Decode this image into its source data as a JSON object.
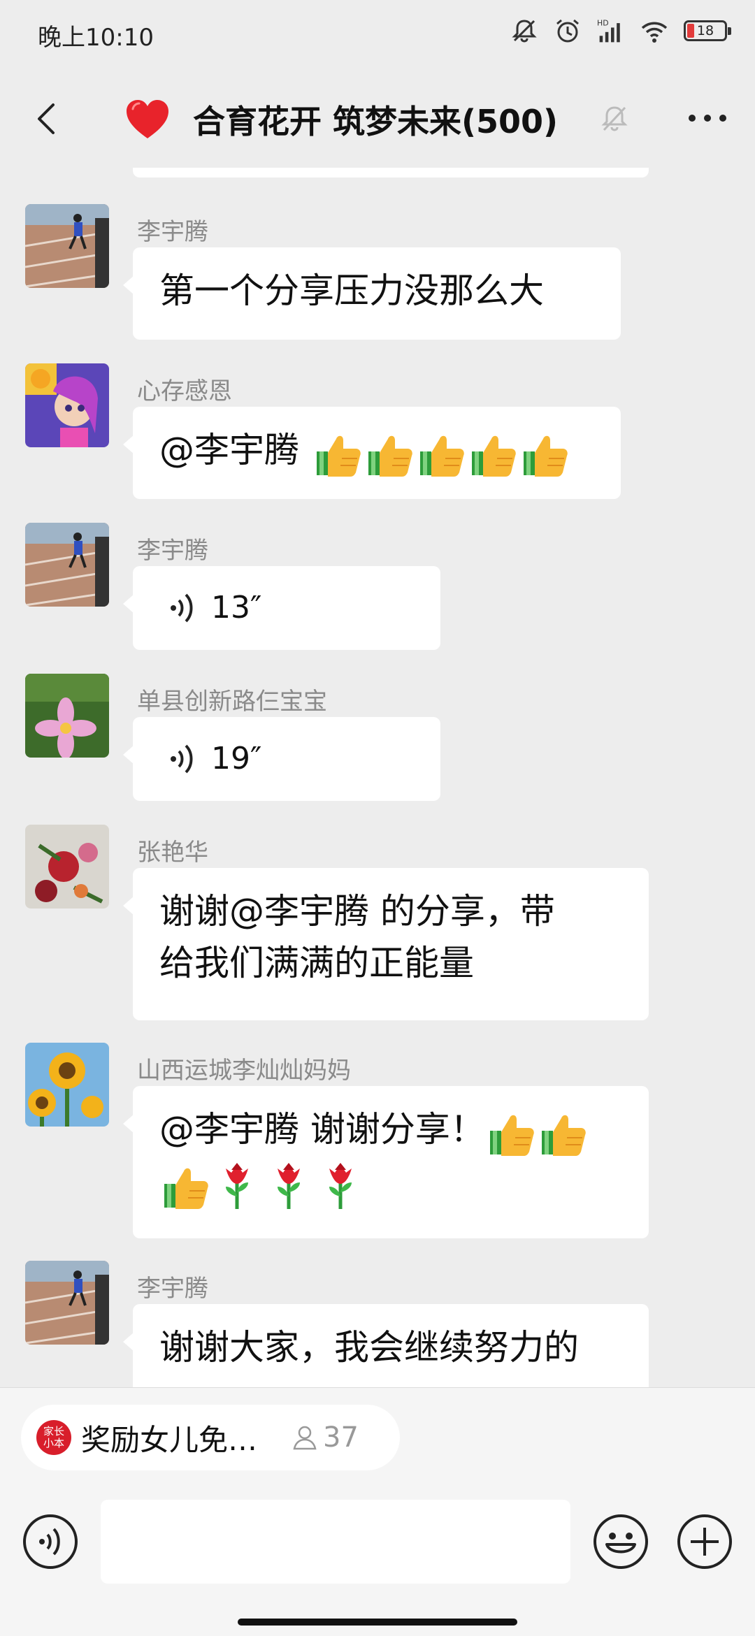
{
  "status_bar": {
    "time": "晚上10:10",
    "battery": "18",
    "network_label": "HD"
  },
  "header": {
    "title": "合育花开 筑梦未来(500)"
  },
  "messages": [
    {
      "sender": "李宇腾",
      "text": "第一个分享压力没那么大"
    },
    {
      "sender": "心存感恩",
      "mention": "@李宇腾",
      "emoji": [
        "thumbs-up",
        "thumbs-up",
        "thumbs-up",
        "thumbs-up",
        "thumbs-up"
      ]
    },
    {
      "sender": "李宇腾",
      "voice": "13″"
    },
    {
      "sender": "单县创新路仨宝宝",
      "voice": "19″"
    },
    {
      "sender": "张艳华",
      "line1": "谢谢@李宇腾  的分享，带",
      "line2": "给我们满满的正能量"
    },
    {
      "sender": "山西运城李灿灿妈妈",
      "line1": "@李宇腾  谢谢分享！",
      "emoji": [
        "thumbs-up",
        "thumbs-up",
        "thumbs-up",
        "rose",
        "rose",
        "rose"
      ]
    },
    {
      "sender": "李宇腾",
      "text": "谢谢大家，我会继续努力的"
    }
  ],
  "pinned": {
    "logo_top": "家长",
    "logo_bottom": "小本",
    "text": "奖励女儿免…",
    "count": "37"
  },
  "colors": {
    "background": "#ededed",
    "bubble": "#ffffff",
    "sender": "#8a8a8a",
    "heart": "#e8232b"
  }
}
